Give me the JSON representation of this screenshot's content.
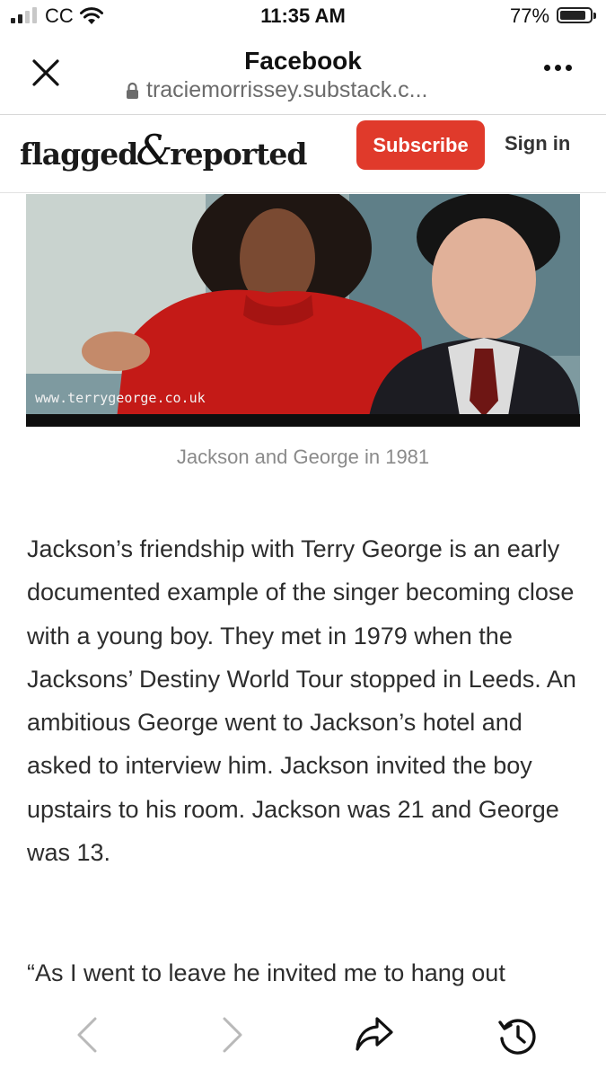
{
  "status_bar": {
    "carrier": "CC",
    "time": "11:35 AM",
    "battery_percent": "77%",
    "battery_level": 0.77,
    "signal_bars": 2
  },
  "browser": {
    "title": "Facebook",
    "url": "traciemorrissey.substack.c..."
  },
  "site": {
    "logo_left": "flagged",
    "logo_amp": "&",
    "logo_right": "reported",
    "subscribe_label": "Subscribe",
    "signin_label": "Sign in",
    "accent_color": "#e03a2b"
  },
  "photo": {
    "watermark": "www.terrygeorge.co.uk",
    "caption": "Jackson and George in 1981"
  },
  "article": {
    "paragraph1": "Jackson’s friendship with Terry George is an early documented example of the singer becoming close with a young boy. They met in 1979 when the Jacksons’ Destiny World Tour stopped in Leeds. An ambitious George went to Jackson’s hotel and asked to interview him. Jackson invited the boy upstairs to his room. Jackson was 21 and George was 13.",
    "paragraph2": "“As I went to leave he invited me to hang out"
  },
  "toolbar": {
    "icons": [
      "back-icon",
      "forward-icon",
      "share-icon",
      "history-icon"
    ]
  }
}
